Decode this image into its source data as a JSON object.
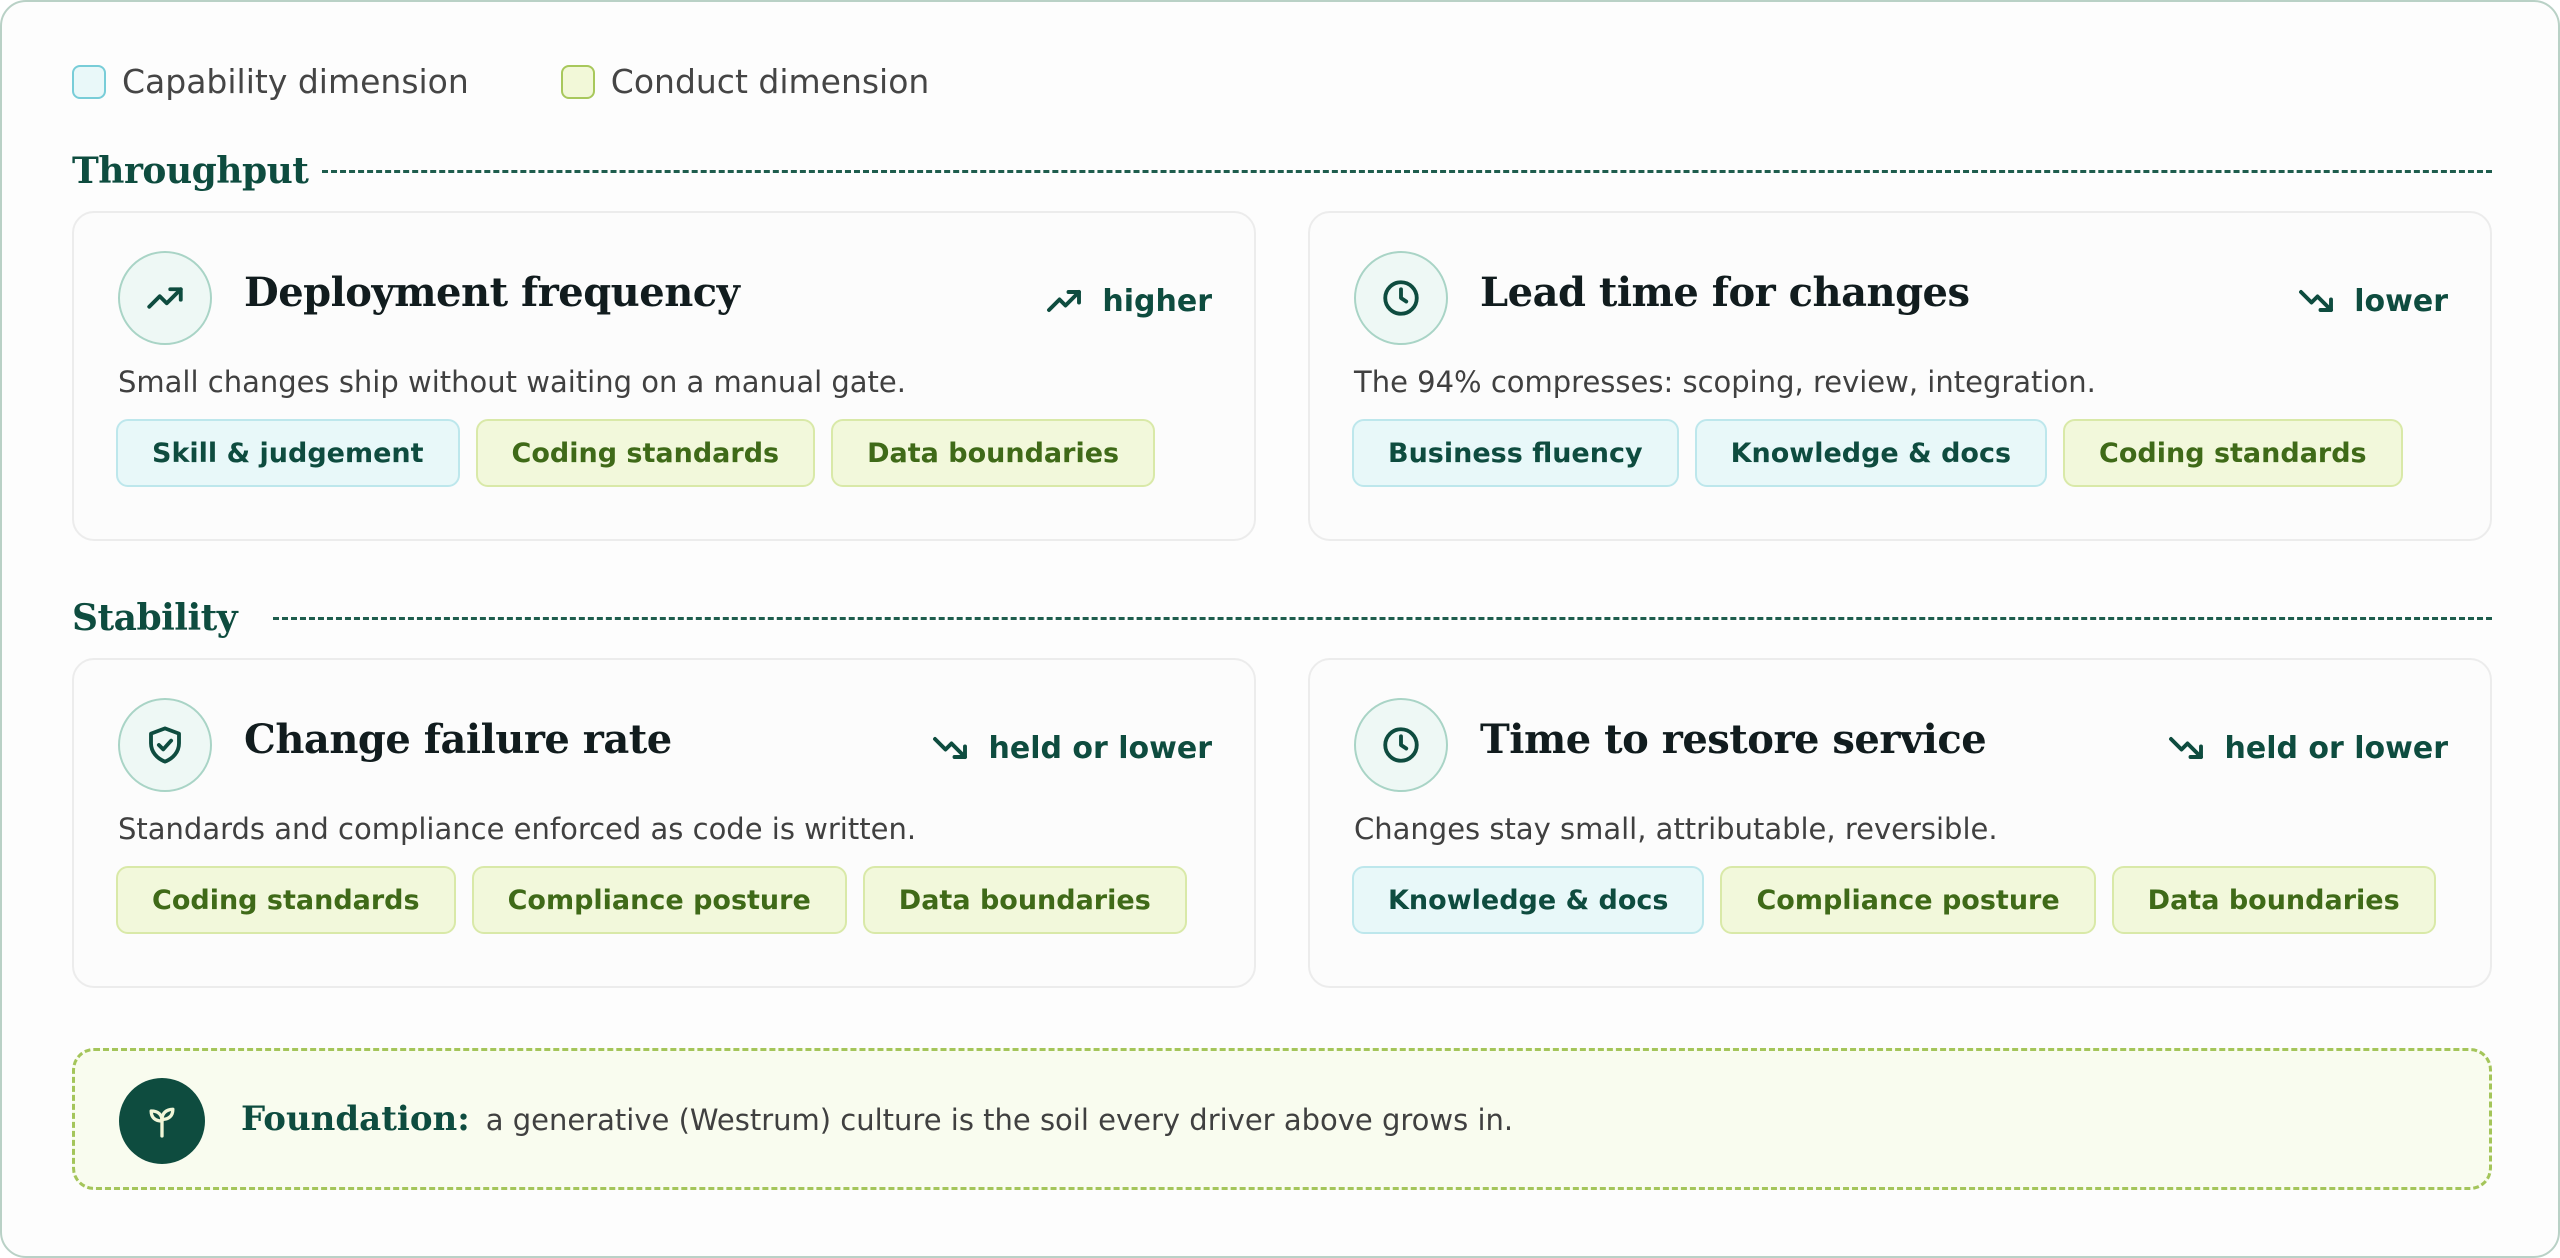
{
  "legend": {
    "capability": "Capability dimension",
    "conduct": "Conduct dimension"
  },
  "sections": [
    {
      "title": "Throughput",
      "cards": [
        {
          "icon": "trending-up-icon",
          "title": "Deployment frequency",
          "trend_icon": "trend-up-icon",
          "trend": "higher",
          "description": "Small changes ship without waiting on a manual gate.",
          "tags": [
            {
              "label": "Skill & judgement",
              "kind": "capability"
            },
            {
              "label": "Coding standards",
              "kind": "conduct"
            },
            {
              "label": "Data boundaries",
              "kind": "conduct"
            }
          ]
        },
        {
          "icon": "clock-icon",
          "title": "Lead time for changes",
          "trend_icon": "trend-down-icon",
          "trend": "lower",
          "description": "The 94% compresses: scoping, review, integration.",
          "tags": [
            {
              "label": "Business fluency",
              "kind": "capability"
            },
            {
              "label": "Knowledge & docs",
              "kind": "capability"
            },
            {
              "label": "Coding standards",
              "kind": "conduct"
            }
          ]
        }
      ]
    },
    {
      "title": "Stability",
      "cards": [
        {
          "icon": "shield-check-icon",
          "title": "Change failure rate",
          "trend_icon": "trend-down-icon",
          "trend": "held or lower",
          "description": "Standards and compliance enforced as code is written.",
          "tags": [
            {
              "label": "Coding standards",
              "kind": "conduct"
            },
            {
              "label": "Compliance posture",
              "kind": "conduct"
            },
            {
              "label": "Data boundaries",
              "kind": "conduct"
            }
          ]
        },
        {
          "icon": "clock-icon",
          "title": "Time to restore service",
          "trend_icon": "trend-down-icon",
          "trend": "held or lower",
          "description": "Changes stay small, attributable, reversible.",
          "tags": [
            {
              "label": "Knowledge & docs",
              "kind": "capability"
            },
            {
              "label": "Compliance posture",
              "kind": "conduct"
            },
            {
              "label": "Data boundaries",
              "kind": "conduct"
            }
          ]
        }
      ]
    }
  ],
  "foundation": {
    "icon": "sprout-icon",
    "title": "Foundation:",
    "text": "a generative (Westrum) culture is the soil every driver above grows in."
  },
  "colors": {
    "primary": "#0e4c3f",
    "capability_bg": "#e8f8f9",
    "capability_border": "#78cdd8",
    "conduct_bg": "#f2f8db",
    "conduct_border": "#a8c85c"
  }
}
